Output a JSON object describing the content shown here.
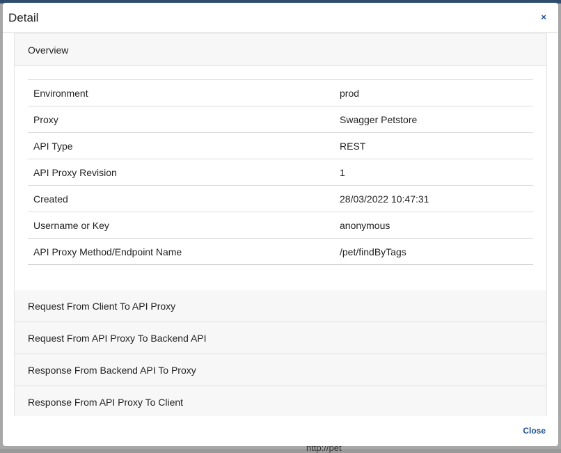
{
  "modal": {
    "title": "Detail",
    "close_icon": "×",
    "footer_close_label": "Close"
  },
  "overview": {
    "heading": "Overview",
    "rows": [
      {
        "key": "Environment",
        "value": "prod"
      },
      {
        "key": "Proxy",
        "value": "Swagger Petstore"
      },
      {
        "key": "API Type",
        "value": "REST"
      },
      {
        "key": "API Proxy Revision",
        "value": "1"
      },
      {
        "key": "Created",
        "value": "28/03/2022 10:47:31"
      },
      {
        "key": "Username or Key",
        "value": "anonymous"
      },
      {
        "key": "API Proxy Method/Endpoint Name",
        "value": "/pet/findByTags"
      }
    ]
  },
  "sections": [
    {
      "heading": "Request From Client To API Proxy"
    },
    {
      "heading": "Request From API Proxy To Backend API"
    },
    {
      "heading": "Response From Backend API To Proxy"
    },
    {
      "heading": "Response From API Proxy To Client"
    }
  ],
  "background": {
    "bottom_text": "http://pet"
  },
  "colors": {
    "accent": "#1d4f91",
    "panel_heading_bg": "#f7f7f7",
    "backdrop": "#a7a7a7"
  }
}
